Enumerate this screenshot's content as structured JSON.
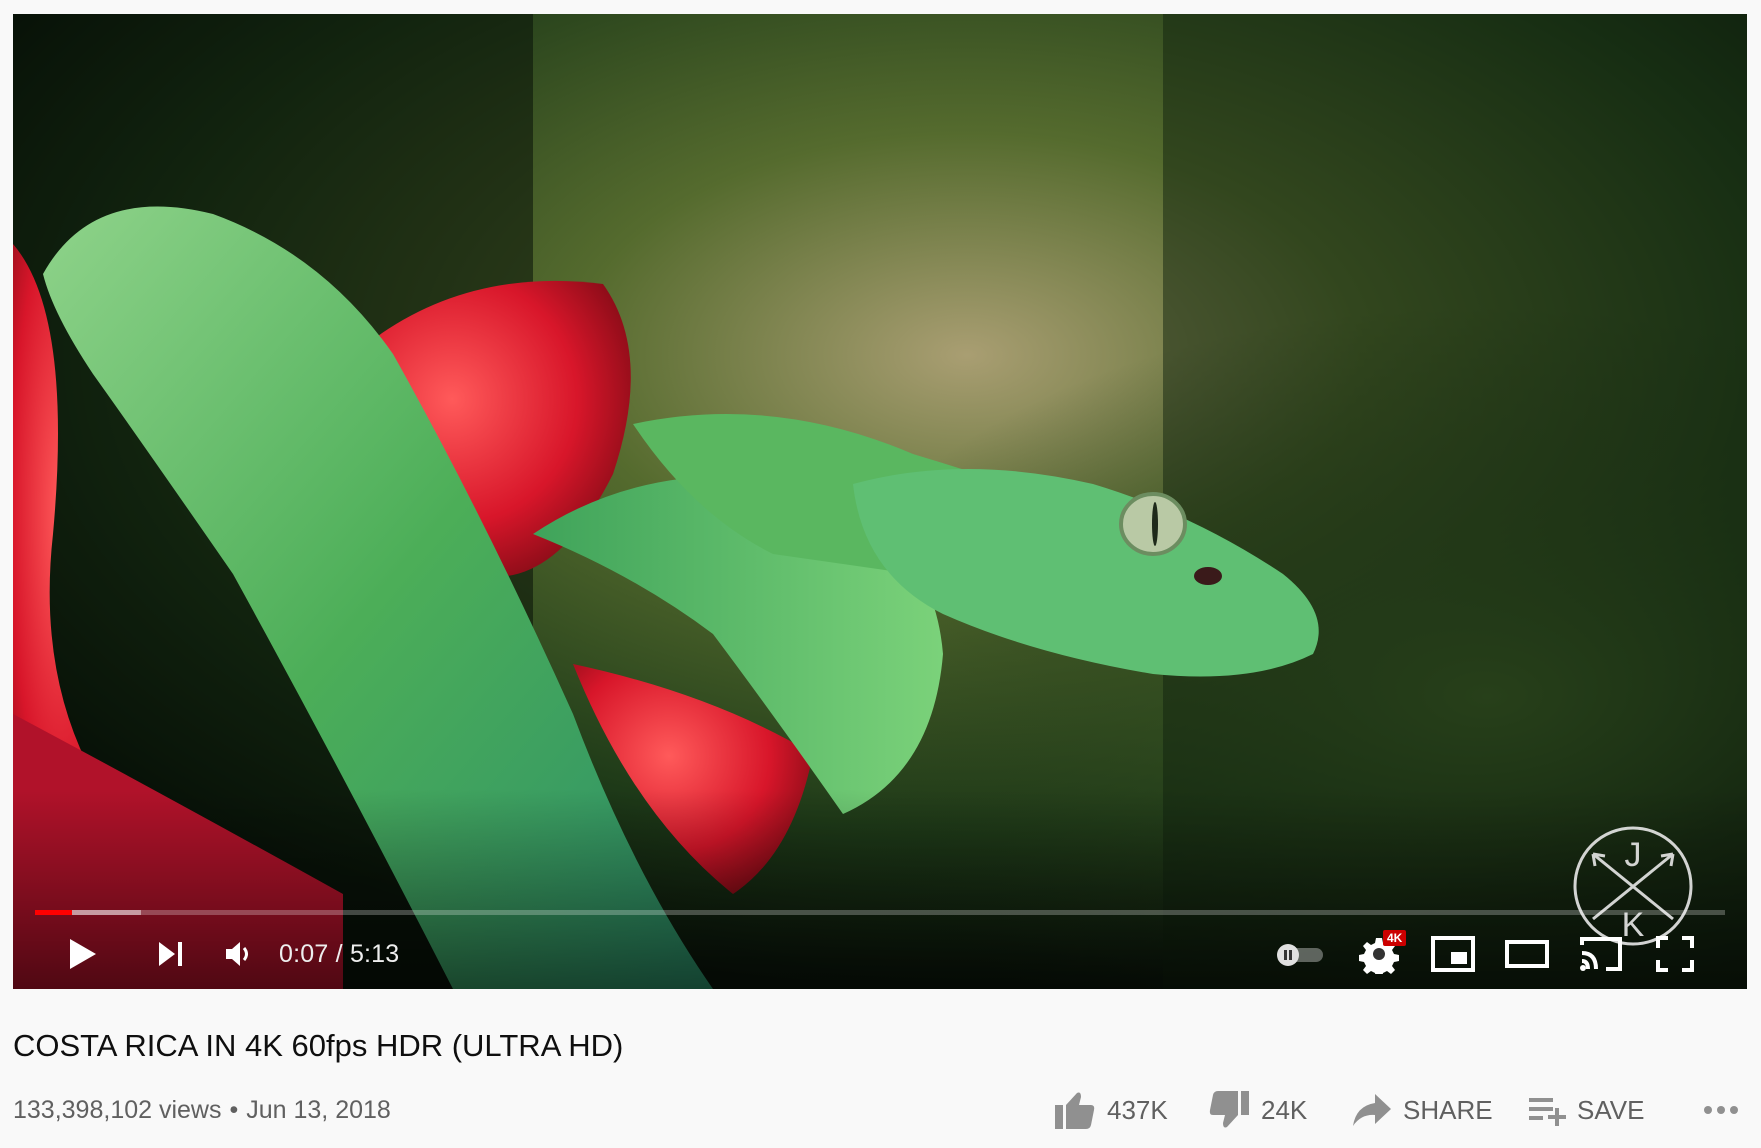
{
  "video": {
    "title": "COSTA RICA IN 4K 60fps HDR (ULTRA HD)",
    "views": "133,398,102 views",
    "separator": "•",
    "date": "Jun 13, 2018"
  },
  "player": {
    "current_time": "0:07",
    "time_separator": "/",
    "duration": "5:13",
    "time_display": "0:07 / 5:13",
    "progress_fraction": 0.022,
    "buffered_fraction": 0.063,
    "quality_badge": "4K",
    "watermark_letters": [
      "J",
      "K"
    ]
  },
  "actions": {
    "like_count": "437K",
    "dislike_count": "24K",
    "share_label": "SHARE",
    "save_label": "SAVE"
  },
  "colors": {
    "progress_played": "#ff0000",
    "badge": "#cc0000",
    "text_primary": "#0f0f0f",
    "text_secondary": "#606060",
    "icon": "#909090"
  },
  "icons": {
    "play": "play-icon",
    "next": "next-icon",
    "volume": "volume-icon",
    "autoplay": "autoplay-toggle-icon",
    "settings": "settings-gear-icon",
    "miniplayer": "miniplayer-icon",
    "theater": "theater-mode-icon",
    "cast": "cast-icon",
    "fullscreen": "fullscreen-icon",
    "like": "thumbs-up-icon",
    "dislike": "thumbs-down-icon",
    "share": "share-arrow-icon",
    "save": "save-playlist-icon",
    "more": "more-dots-icon"
  }
}
